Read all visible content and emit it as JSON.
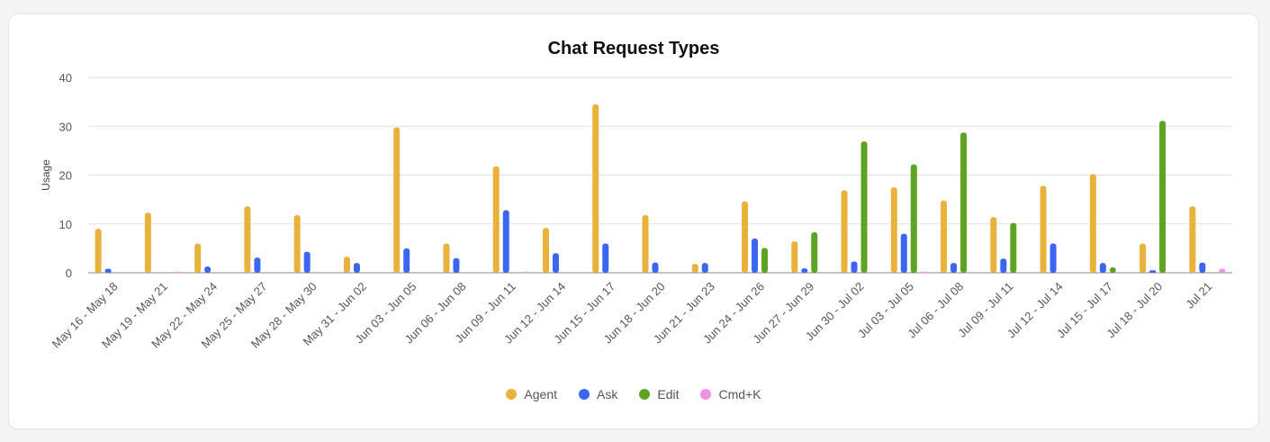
{
  "chart_data": {
    "type": "bar",
    "title": "Chat Request Types",
    "ylabel": "Usage",
    "xlabel": "",
    "ylim": [
      0,
      40
    ],
    "yticks": [
      0,
      10,
      20,
      30,
      40
    ],
    "grid": true,
    "legend_position": "bottom",
    "categories": [
      "May 16 - May 18",
      "May 19 - May 21",
      "May 22 - May 24",
      "May 25 - May 27",
      "May 28 - May 30",
      "May 31 - Jun 02",
      "Jun 03 - Jun 05",
      "Jun 06 - Jun 08",
      "Jun 09 - Jun 11",
      "Jun 12 - Jun 14",
      "Jun 15 - Jun 17",
      "Jun 18 - Jun 20",
      "Jun 21 - Jun 23",
      "Jun 24 - Jun 26",
      "Jun 27 - Jun 29",
      "Jun 30 - Jul 02",
      "Jul 03 - Jul 05",
      "Jul 06 - Jul 08",
      "Jul 09 - Jul 11",
      "Jul 12 - Jul 14",
      "Jul 15 - Jul 17",
      "Jul 18 - Jul 20",
      "Jul 21"
    ],
    "series": [
      {
        "name": "Agent",
        "color": "#e9b23c",
        "values": [
          9,
          12.3,
          6,
          13.6,
          11.8,
          3.3,
          29.8,
          6,
          21.8,
          9.2,
          34.5,
          11.8,
          1.8,
          14.6,
          6.4,
          16.9,
          17.5,
          14.8,
          11.4,
          17.8,
          20.2,
          6,
          13.6
        ]
      },
      {
        "name": "Ask",
        "color": "#3a66f2",
        "values": [
          0.8,
          0,
          1.3,
          3.1,
          4.3,
          2,
          5,
          3,
          12.8,
          4,
          6,
          2.1,
          2,
          7,
          0.9,
          2.3,
          8,
          2,
          2.9,
          6,
          2,
          0.5,
          2.1
        ]
      },
      {
        "name": "Edit",
        "color": "#5da324",
        "values": [
          0,
          0,
          0,
          0,
          0,
          0,
          0,
          0,
          0,
          0,
          0,
          0,
          0,
          5.1,
          8.3,
          26.9,
          22.2,
          28.7,
          10.2,
          0,
          1.1,
          31.1,
          0
        ]
      },
      {
        "name": "Cmd+K",
        "color": "#ee92e3",
        "values": [
          0,
          0.2,
          0,
          0,
          0,
          0,
          0,
          0,
          0.2,
          0,
          0,
          0,
          0,
          0,
          0,
          0,
          0.2,
          0,
          0,
          0,
          0,
          0,
          0.8
        ]
      }
    ]
  }
}
